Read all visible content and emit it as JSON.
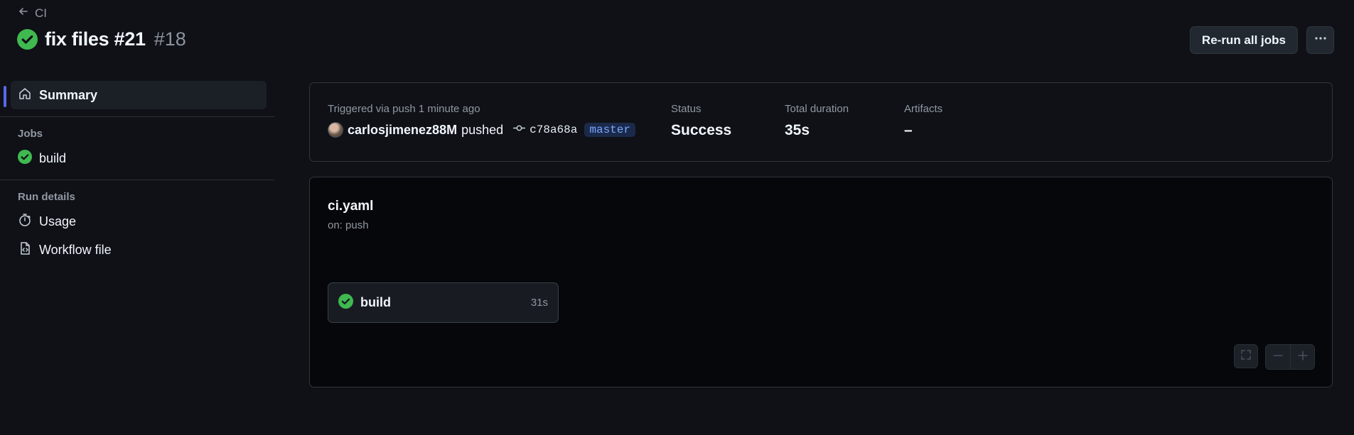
{
  "header": {
    "back_label": "CI",
    "title": "fix files #21",
    "run_number": "#18",
    "rerun_label": "Re-run all jobs"
  },
  "sidebar": {
    "summary_label": "Summary",
    "jobs_section": "Jobs",
    "jobs": [
      {
        "label": "build",
        "status": "success"
      }
    ],
    "run_details_section": "Run details",
    "usage_label": "Usage",
    "workflow_file_label": "Workflow file"
  },
  "summary": {
    "trigger_text": "Triggered via push 1 minute ago",
    "user": "carlosjimenez88M",
    "pushed": "pushed",
    "commit": "c78a68a",
    "branch": "master",
    "status_label": "Status",
    "status_value": "Success",
    "duration_label": "Total duration",
    "duration_value": "35s",
    "artifacts_label": "Artifacts",
    "artifacts_value": "–"
  },
  "workflow": {
    "name": "ci.yaml",
    "trigger": "on: push",
    "job": {
      "name": "build",
      "duration": "31s"
    }
  },
  "colors": {
    "success": "#3fb950",
    "accent": "#5868e6",
    "branch_text": "#79a6ff"
  }
}
